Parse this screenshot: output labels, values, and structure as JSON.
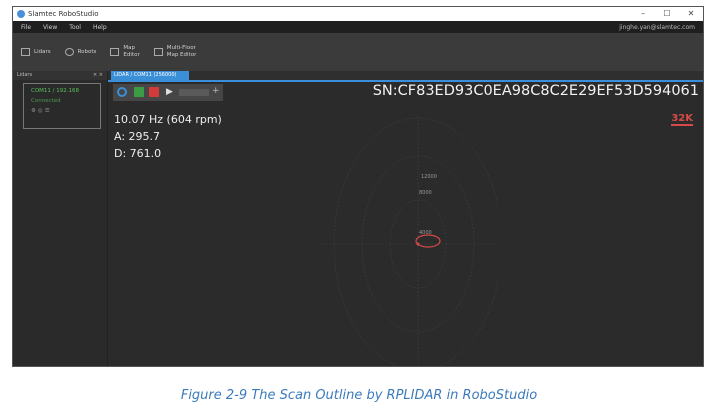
{
  "window": {
    "title": "Slamtec RoboStudio",
    "controls": [
      "–",
      "☐",
      "✕"
    ]
  },
  "menu": {
    "items": [
      "File",
      "View",
      "Tool",
      "Help"
    ],
    "user": "jinghe.yan@slamtec.com"
  },
  "toolbar": {
    "items": [
      {
        "label": "Lidars",
        "icon": "lidar-icon"
      },
      {
        "label": "Robots",
        "icon": "robot-icon"
      },
      {
        "label": "Map\nEditor",
        "icon": "map-editor-icon"
      },
      {
        "label": "Multi-Floor\nMap Editor",
        "icon": "multi-floor-icon"
      }
    ]
  },
  "sidebar": {
    "header": "Lidars",
    "device": {
      "name": "COM11 / 192.168",
      "status": "Connected"
    }
  },
  "tab": {
    "label": "LIDAR / COM11 (256000)"
  },
  "readout": {
    "frequency": "10.07 Hz (604 rpm)",
    "angle": "A: 295.7",
    "distance": "D: 761.0"
  },
  "serial": "SN:CF83ED93C0EA98C8C2E29EF53D594061",
  "point_count": "32K",
  "colors": {
    "accent": "#3a8fd8",
    "start": "#3c9b45",
    "stop": "#d43a3a",
    "status": "#59c05a",
    "scan": "#d84a4a"
  },
  "caption": "Figure 2-9 The Scan Outline by RPLIDAR in RoboStudio"
}
